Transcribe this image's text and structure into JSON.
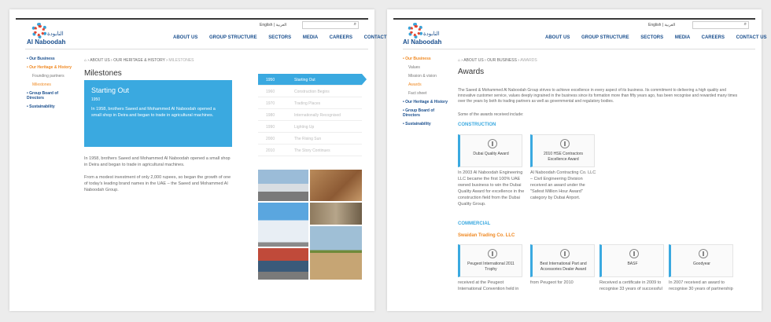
{
  "brand": {
    "name_en": "Al Naboodah",
    "name_ar": "النابودة"
  },
  "lang": {
    "english": "English",
    "arabic": "العربية"
  },
  "nav": [
    "ABOUT US",
    "GROUP STRUCTURE",
    "SECTORS",
    "MEDIA",
    "CAREERS",
    "CONTACT US"
  ],
  "colors": {
    "blue": "#3aa9e0",
    "orange": "#f08a24",
    "navy": "#1a4f8e"
  },
  "left": {
    "sidebar": {
      "our_business": "Our Business",
      "heritage": "Our Heritage & History",
      "founding": "Founding partners",
      "milestones": "Milestones",
      "board": "Group Board of Directors",
      "sustainability": "Sustainability"
    },
    "breadcrumb": [
      "ABOUT US",
      "OUR HERITAGE & HISTORY",
      "MILESTONES"
    ],
    "title": "Milestones",
    "feature": {
      "title": "Starting Out",
      "year": "1950",
      "text": "In 1958, brothers Saeed and Mohammed Al Naboodah opened a small shop in Deira and began to trade in agricultural machines."
    },
    "para1": "In 1958, brothers Saeed and Mohammed Al Naboodah opened a small shop in Deira and began to trade in agricultural machines.",
    "para2": "From a modest investment of only 2,000 rupees, so began the growth of one of today's leading brand names in the UAE – the Saeed and Mohammed Al Naboodah Group.",
    "timeline": [
      {
        "year": "1950",
        "label": "Starting Out"
      },
      {
        "year": "1960",
        "label": "Construction Begins"
      },
      {
        "year": "1970",
        "label": "Trading Places"
      },
      {
        "year": "1980",
        "label": "Internationally Recognised"
      },
      {
        "year": "1990",
        "label": "Lighting Up"
      },
      {
        "year": "2000",
        "label": "The Rising Sun"
      },
      {
        "year": "2010",
        "label": "The Story Continues"
      }
    ]
  },
  "right": {
    "sidebar": {
      "our_business": "Our Business",
      "values": "Values",
      "mission": "Mission & vision",
      "awards": "Awards",
      "factsheet": "Fact sheet",
      "heritage": "Our Heritage & History",
      "board": "Group Board of Directors",
      "sustainability": "Sustainability"
    },
    "breadcrumb": [
      "ABOUT US",
      "OUR BUSINESS",
      "AWARDS"
    ],
    "title": "Awards",
    "intro": "The Saeed & Mohammed Al Naboodah Group strives to achieve excellence in every aspect of its business. Its commitment to delivering a high quality and innovative customer service, values deeply ingrained in the business since its formation more than fifty years ago, has been recognise and rewarded many times over the years by both its trading partners as well as governmental and regulatory bodies.",
    "lead": "Some of the awards received include:",
    "construction": "CONSTRUCTION",
    "awards1": [
      {
        "name": "Dubai Quality Award",
        "text": "In 2003 Al Naboodah Engineering LLC became the first 100% UAE owned business to win the Dubai Quality Award for excellence in the construction field from the Dubai Quality Group."
      },
      {
        "name": "2010 HSE Contractors Excellence Award",
        "text": "Al Naboodah Contracting Co. LLC – Civil Engineering Division received an award under the \"Safest Million Hour Award\" category by Dubai Airport."
      }
    ],
    "commercial": "COMMERCIAL",
    "company": "Swaidan Trading Co. LLC",
    "awards2": [
      {
        "name": "Peugeot International 2011 Trophy",
        "text": "received at the Peugeot International Convention held in"
      },
      {
        "name": "Best International Part and Accessories Dealer Award",
        "text": "from Peugeot for 2010"
      },
      {
        "name": "BASF",
        "text": "Received a certificate in 2009 to recognise 33 years of successful"
      },
      {
        "name": "Goodyear",
        "text": "In 2007 received an award to recognise 30 years of partnership"
      }
    ]
  }
}
